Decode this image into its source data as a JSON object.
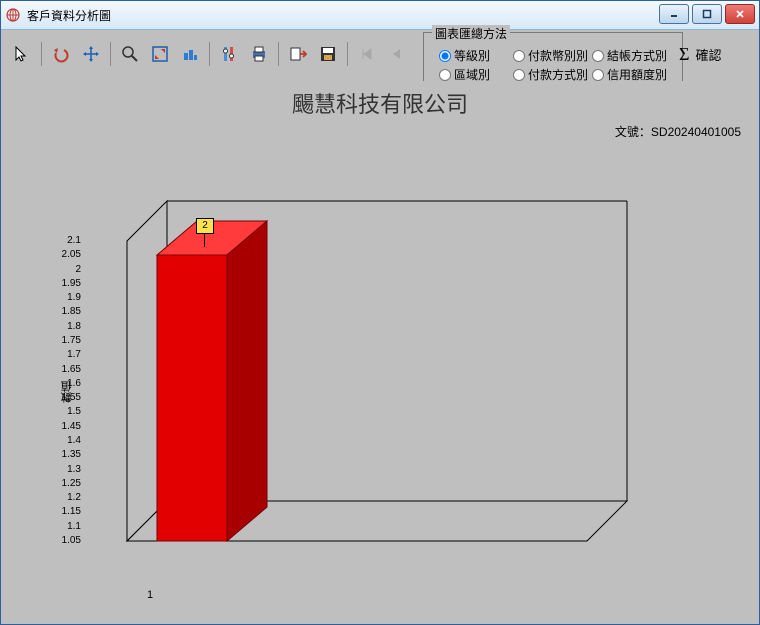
{
  "window": {
    "title": "客戶資料分析圖"
  },
  "toolbar": {
    "group_title": "圖表匯總方法",
    "radios": [
      {
        "label": "等級別",
        "checked": true
      },
      {
        "label": "付款幣別別",
        "checked": false
      },
      {
        "label": "結帳方式別",
        "checked": false
      },
      {
        "label": "區域別",
        "checked": false
      },
      {
        "label": "付款方式別",
        "checked": false
      },
      {
        "label": "信用額度別",
        "checked": false
      }
    ],
    "confirm_label": "確認"
  },
  "header": {
    "company": "颺慧科技有限公司",
    "docno_label": "文號：",
    "docno": "SD20240401005"
  },
  "chart_data": {
    "type": "bar",
    "categories": [
      "1"
    ],
    "values": [
      2
    ],
    "ylabel": "數值",
    "ylim": [
      1.05,
      2.1
    ],
    "yticks": [
      2.1,
      2.05,
      2,
      1.95,
      1.9,
      1.85,
      1.8,
      1.75,
      1.7,
      1.65,
      1.6,
      1.55,
      1.5,
      1.45,
      1.4,
      1.35,
      1.3,
      1.25,
      1.2,
      1.15,
      1.1,
      1.05
    ],
    "marker_value": "2"
  }
}
